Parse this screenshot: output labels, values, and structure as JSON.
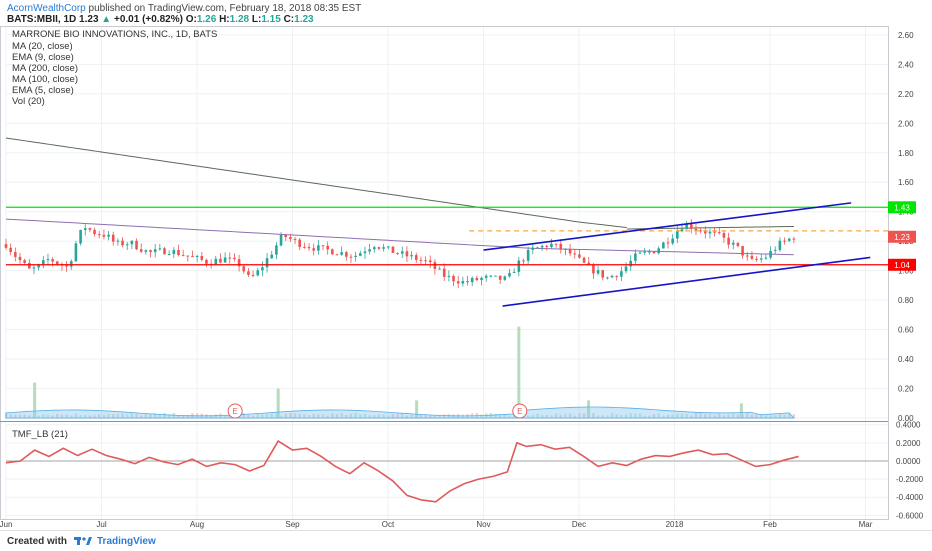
{
  "header": {
    "user": "AcornWealthCorp",
    "published": "published on TradingView.com, February 18, 2018 08:35 EST",
    "symbol": "BATS:MBII, 1D",
    "last": "1.23",
    "change": "+0.01 (+0.82%)",
    "o_label": "O:",
    "o": "1.26",
    "h_label": "H:",
    "h": "1.28",
    "l_label": "L:",
    "l": "1.15",
    "c_label": "C:",
    "c": "1.23"
  },
  "legend": {
    "title": "MARRONE BIO INNOVATIONS, INC., 1D, BATS",
    "items": [
      "MA (20, close)",
      "EMA (9, close)",
      "MA (200, close)",
      "MA (100, close)",
      "EMA (5, close)",
      "Vol (20)"
    ]
  },
  "indicator_label": "TMF_LB (21)",
  "footer": {
    "created": "Created with",
    "brand": "TradingView"
  },
  "colors": {
    "up": "#26a69a",
    "down": "#ef5350",
    "green_level": "#00e600",
    "red_level": "#ff0000",
    "channel": "#1515c8",
    "orange": "#f7a545",
    "tmf": "#e05a5a"
  },
  "chart_data": [
    {
      "type": "candlestick",
      "x_ticks": [
        "Jun",
        "Jul",
        "Aug",
        "Sep",
        "Oct",
        "Nov",
        "Dec",
        "2018",
        "Feb",
        "Mar"
      ],
      "y_ticks": [
        "2.60",
        "2.40",
        "2.20",
        "2.00",
        "1.80",
        "1.60",
        "1.40",
        "1.20",
        "1.00",
        "0.80",
        "0.60",
        "0.40",
        "0.20",
        "0.00"
      ],
      "ylim": [
        -0.02,
        2.66
      ],
      "price_labels": [
        {
          "value": 1.43,
          "text": "1.43",
          "color": "#00e600"
        },
        {
          "value": 1.23,
          "text": "1.23",
          "color": "#ef5350"
        },
        {
          "value": 1.04,
          "text": "1.04",
          "color": "#ff0000"
        }
      ],
      "levels": [
        {
          "value": 1.43,
          "color": "#00e600",
          "style": "solid"
        },
        {
          "value": 1.04,
          "color": "#ff0000",
          "style": "solid"
        },
        {
          "value": 1.27,
          "color": "#f7a545",
          "style": "dashed",
          "from_month": 4.85
        }
      ],
      "channel": [
        {
          "from": [
            5.0,
            1.14
          ],
          "to": [
            8.85,
            1.46
          ]
        },
        {
          "from": [
            5.2,
            0.76
          ],
          "to": [
            9.05,
            1.09
          ]
        }
      ],
      "events": [
        {
          "label": "E",
          "x": 2.4
        },
        {
          "label": "E",
          "x": 5.38
        }
      ],
      "close_path": [
        [
          0.0,
          1.18
        ],
        [
          0.1,
          1.1
        ],
        [
          0.25,
          1.0
        ],
        [
          0.35,
          1.03
        ],
        [
          0.45,
          1.08
        ],
        [
          0.55,
          1.05
        ],
        [
          0.65,
          1.02
        ],
        [
          0.75,
          1.22
        ],
        [
          0.82,
          1.3
        ],
        [
          0.92,
          1.26
        ],
        [
          1.05,
          1.24
        ],
        [
          1.15,
          1.18
        ],
        [
          1.3,
          1.19
        ],
        [
          1.5,
          1.12
        ],
        [
          1.7,
          1.14
        ],
        [
          1.9,
          1.1
        ],
        [
          2.1,
          1.06
        ],
        [
          2.3,
          1.08
        ],
        [
          2.45,
          1.04
        ],
        [
          2.55,
          0.94
        ],
        [
          2.65,
          1.0
        ],
        [
          2.8,
          1.14
        ],
        [
          2.9,
          1.24
        ],
        [
          3.05,
          1.19
        ],
        [
          3.2,
          1.16
        ],
        [
          3.45,
          1.13
        ],
        [
          3.65,
          1.1
        ],
        [
          3.85,
          1.18
        ],
        [
          4.0,
          1.14
        ],
        [
          4.2,
          1.1
        ],
        [
          4.4,
          1.06
        ],
        [
          4.6,
          0.96
        ],
        [
          4.8,
          0.92
        ],
        [
          5.0,
          0.95
        ],
        [
          5.25,
          0.94
        ],
        [
          5.35,
          1.04
        ],
        [
          5.5,
          1.14
        ],
        [
          5.7,
          1.18
        ],
        [
          5.9,
          1.12
        ],
        [
          6.1,
          1.02
        ],
        [
          6.3,
          0.95
        ],
        [
          6.45,
          1.0
        ],
        [
          6.6,
          1.1
        ],
        [
          6.8,
          1.14
        ],
        [
          6.95,
          1.22
        ],
        [
          7.1,
          1.32
        ],
        [
          7.25,
          1.28
        ],
        [
          7.45,
          1.24
        ],
        [
          7.65,
          1.16
        ],
        [
          7.8,
          1.06
        ],
        [
          7.95,
          1.09
        ],
        [
          8.1,
          1.18
        ],
        [
          8.25,
          1.23
        ]
      ],
      "volume_spikes": [
        {
          "x": 0.3,
          "v": 0.24
        },
        {
          "x": 2.85,
          "v": 0.2
        },
        {
          "x": 4.3,
          "v": 0.12
        },
        {
          "x": 5.37,
          "v": 0.62
        },
        {
          "x": 6.1,
          "v": 0.12
        },
        {
          "x": 7.7,
          "v": 0.1
        }
      ]
    },
    {
      "type": "line",
      "name": "TMF_LB (21)",
      "y_ticks": [
        "0.4000",
        "0.2000",
        "0.0000",
        "-0.2000",
        "-0.4000",
        "-0.6000"
      ],
      "ylim": [
        -0.64,
        0.43
      ],
      "x": [
        0.0,
        0.15,
        0.3,
        0.45,
        0.6,
        0.75,
        0.9,
        1.05,
        1.2,
        1.35,
        1.5,
        1.65,
        1.8,
        1.95,
        2.1,
        2.25,
        2.4,
        2.55,
        2.7,
        2.85,
        3.0,
        3.15,
        3.3,
        3.45,
        3.6,
        3.75,
        3.9,
        4.05,
        4.2,
        4.35,
        4.5,
        4.65,
        4.8,
        4.95,
        5.1,
        5.25,
        5.35,
        5.45,
        5.6,
        5.75,
        5.9,
        6.05,
        6.2,
        6.35,
        6.5,
        6.65,
        6.8,
        6.95,
        7.1,
        7.25,
        7.4,
        7.55,
        7.7,
        7.85,
        8.0,
        8.15,
        8.3
      ],
      "values": [
        -0.02,
        0.0,
        0.12,
        0.05,
        0.14,
        0.06,
        0.13,
        0.06,
        0.02,
        -0.03,
        0.04,
        -0.01,
        -0.04,
        0.02,
        -0.06,
        -0.02,
        -0.04,
        -0.11,
        -0.05,
        0.22,
        0.12,
        0.14,
        0.05,
        -0.06,
        -0.14,
        -0.02,
        -0.11,
        -0.22,
        -0.38,
        -0.43,
        -0.45,
        -0.33,
        -0.25,
        -0.2,
        -0.17,
        -0.12,
        0.2,
        0.16,
        0.18,
        0.13,
        0.15,
        0.05,
        -0.06,
        -0.02,
        -0.05,
        0.02,
        0.06,
        0.05,
        0.09,
        0.12,
        0.07,
        0.08,
        0.01,
        -0.06,
        -0.04,
        0.01,
        0.05
      ]
    }
  ]
}
